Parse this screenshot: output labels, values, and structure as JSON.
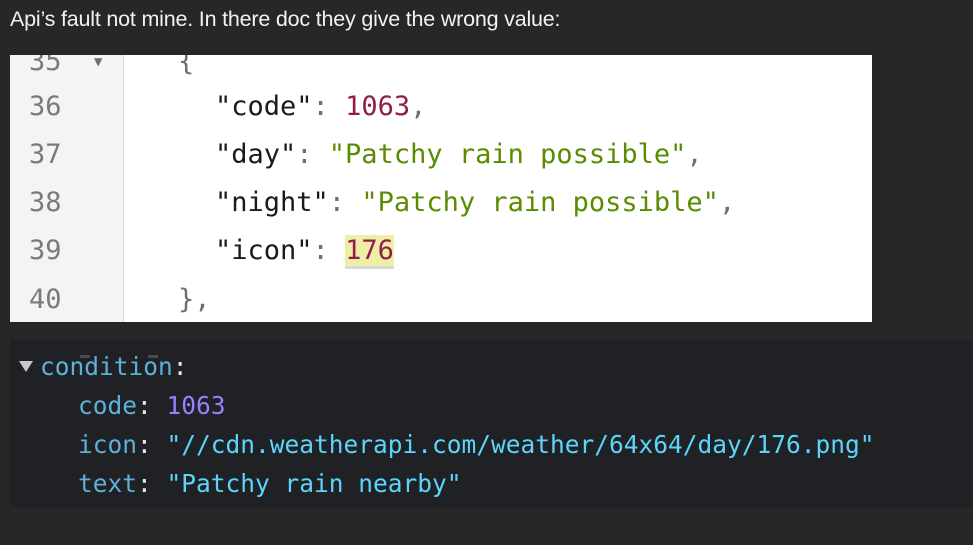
{
  "message": {
    "text": "Api’s fault not mine. In there doc they give the wrong value:"
  },
  "doc_snippet": {
    "lines": [
      {
        "num": "35",
        "fold": "▼",
        "brace": "{"
      },
      {
        "num": "36",
        "key": "\"code\"",
        "colon": ": ",
        "value": "1063",
        "trail": ","
      },
      {
        "num": "37",
        "key": "\"day\"",
        "colon": ": ",
        "value": "\"Patchy rain possible\"",
        "trail": ","
      },
      {
        "num": "38",
        "key": "\"night\"",
        "colon": ": ",
        "value": "\"Patchy rain possible\"",
        "trail": ","
      },
      {
        "num": "39",
        "key": "\"icon\"",
        "colon": ": ",
        "value": "176",
        "trail": ""
      },
      {
        "num": "40",
        "brace": "},"
      }
    ]
  },
  "api_response": {
    "toggle_icon": "triangle-down-icon",
    "object_key": "condition",
    "colon": ":",
    "props": [
      {
        "key": "code",
        "value": "1063"
      },
      {
        "key": "icon",
        "value": "\"//cdn.weatherapi.com/weather/64x64/day/176.png\""
      },
      {
        "key": "text",
        "value": "\"Patchy rain nearby\""
      }
    ]
  },
  "colors": {
    "page_bg": "#272727",
    "number_light": "#8f1f47",
    "string_light": "#5a8c00",
    "highlight": "#efeea8",
    "prop_dark": "#5db0d7",
    "number_dark": "#9980ff",
    "string_dark": "#5cd5fb"
  }
}
